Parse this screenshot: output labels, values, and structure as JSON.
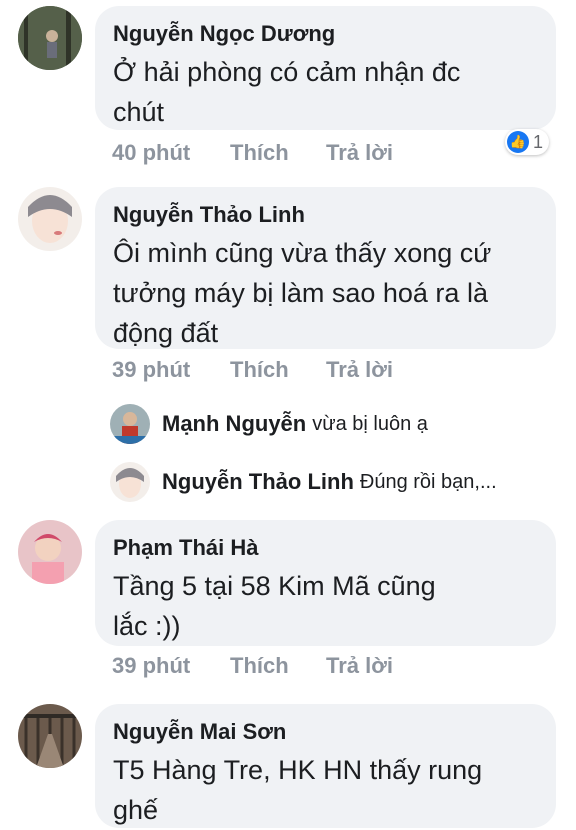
{
  "comments": [
    {
      "author": "Nguyễn Ngọc Dương",
      "text_lines": [
        "Ở hải phòng có cảm nhận đc",
        "chút"
      ],
      "time": "40 phút",
      "like": "Thích",
      "reply": "Trả lời",
      "reaction_count": "1",
      "avatar_icon": "avatar-photo-trees"
    },
    {
      "author": "Nguyễn Thảo Linh",
      "text_lines": [
        "Ôi mình cũng vừa thấy xong cứ",
        "tưởng máy bị làm sao hoá ra là",
        "động đất"
      ],
      "time": "39 phút",
      "like": "Thích",
      "reply": "Trả lời",
      "avatar_icon": "avatar-photo-face",
      "replies": [
        {
          "author": "Mạnh Nguyễn",
          "text": "vừa bị luôn ạ",
          "avatar_icon": "avatar-photo-child"
        },
        {
          "author": "Nguyễn Thảo Linh",
          "text": "Đúng rồi bạn,...",
          "avatar_icon": "avatar-photo-face"
        }
      ]
    },
    {
      "author": "Phạm Thái Hà",
      "text_lines": [
        "Tầng 5 tại 58 Kim Mã cũng",
        "lắc :))"
      ],
      "time": "39 phút",
      "like": "Thích",
      "reply": "Trả lời",
      "avatar_icon": "avatar-photo-baby"
    },
    {
      "author": "Nguyễn Mai Sơn",
      "text_lines": [
        "T5 Hàng Tre, HK HN thấy rung",
        "ghế"
      ],
      "avatar_icon": "avatar-photo-bridge"
    }
  ],
  "colors": {
    "bubble": "#f0f2f5",
    "meta": "#8d949e",
    "like_blue": "#1877f2"
  }
}
